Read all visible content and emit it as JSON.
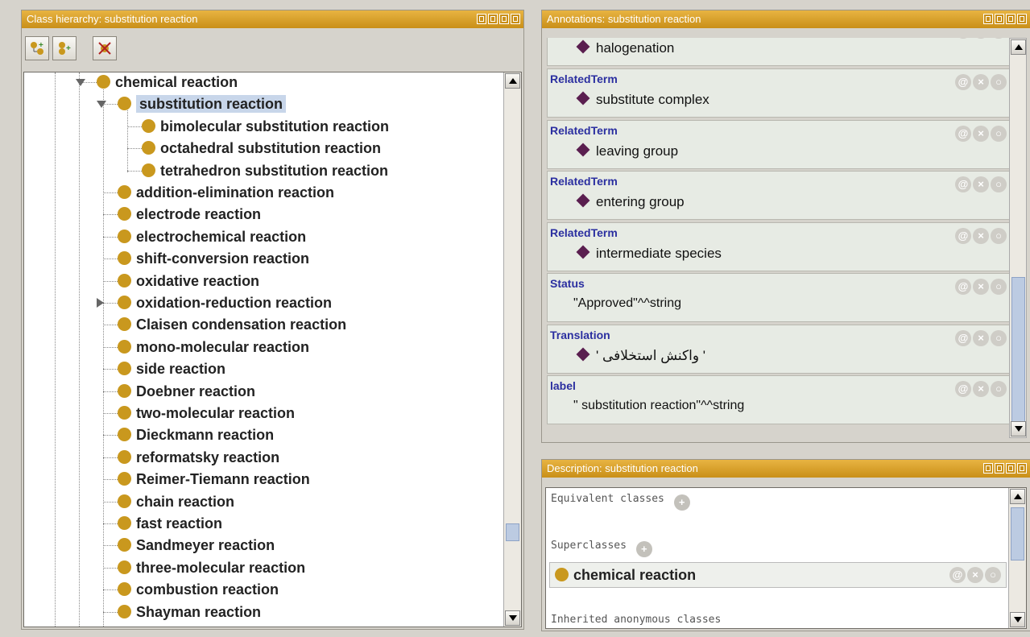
{
  "class_panel": {
    "title": "Class hierarchy:  substitution reaction",
    "tree": [
      {
        "label": "chemical reaction",
        "level": 0,
        "expanded": true
      },
      {
        "label": "substitution reaction",
        "level": 1,
        "expanded": true,
        "selected": true
      },
      {
        "label": "bimolecular substitution reaction",
        "level": 2
      },
      {
        "label": "octahedral substitution reaction",
        "level": 2
      },
      {
        "label": "tetrahedron substitution reaction",
        "level": 2
      },
      {
        "label": "addition-elimination reaction",
        "level": 1
      },
      {
        "label": "electrode reaction",
        "level": 1
      },
      {
        "label": "electrochemical reaction",
        "level": 1
      },
      {
        "label": "shift-conversion reaction",
        "level": 1
      },
      {
        "label": "oxidative reaction",
        "level": 1
      },
      {
        "label": "oxidation-reduction reaction",
        "level": 1,
        "collapsed": true
      },
      {
        "label": "Claisen condensation reaction",
        "level": 1
      },
      {
        "label": "mono-molecular reaction",
        "level": 1
      },
      {
        "label": "side reaction",
        "level": 1
      },
      {
        "label": "Doebner reaction",
        "level": 1
      },
      {
        "label": "two-molecular reaction",
        "level": 1
      },
      {
        "label": "Dieckmann reaction",
        "level": 1
      },
      {
        "label": "reformatsky reaction",
        "level": 1
      },
      {
        "label": "Reimer-Tiemann reaction",
        "level": 1
      },
      {
        "label": "chain reaction",
        "level": 1
      },
      {
        "label": "fast reaction",
        "level": 1
      },
      {
        "label": "Sandmeyer reaction",
        "level": 1
      },
      {
        "label": "three-molecular reaction",
        "level": 1
      },
      {
        "label": "combustion reaction",
        "level": 1
      },
      {
        "label": "Shayman reaction",
        "level": 1
      }
    ]
  },
  "annot_panel": {
    "title": "Annotations: substitution reaction",
    "rows": [
      {
        "key": "RelatedTerm",
        "value": "halogenation",
        "kind": "individual"
      },
      {
        "key": "RelatedTerm",
        "value": "substitute complex",
        "kind": "individual"
      },
      {
        "key": "RelatedTerm",
        "value": "leaving group",
        "kind": "individual"
      },
      {
        "key": "RelatedTerm",
        "value": "entering group",
        "kind": "individual"
      },
      {
        "key": "RelatedTerm",
        "value": "intermediate species",
        "kind": "individual"
      },
      {
        "key": "Status",
        "value": "\"Approved\"^^string",
        "kind": "literal"
      },
      {
        "key": "Translation",
        "value": "' واکنش استخلافی '",
        "kind": "rtl"
      },
      {
        "key": "label",
        "value": "\" substitution reaction\"^^string",
        "kind": "literal"
      }
    ]
  },
  "desc_panel": {
    "title": "Description: substitution reaction",
    "equivalent_label": "Equivalent classes",
    "superclasses_label": "Superclasses",
    "superclass": "chemical reaction",
    "inherited_label": "Inherited anonymous classes"
  },
  "colors": {
    "accent": "#c98f18",
    "class_dot": "#c9981e",
    "annotation_key": "#2b2fa0",
    "individual": "#5a1e4f"
  }
}
